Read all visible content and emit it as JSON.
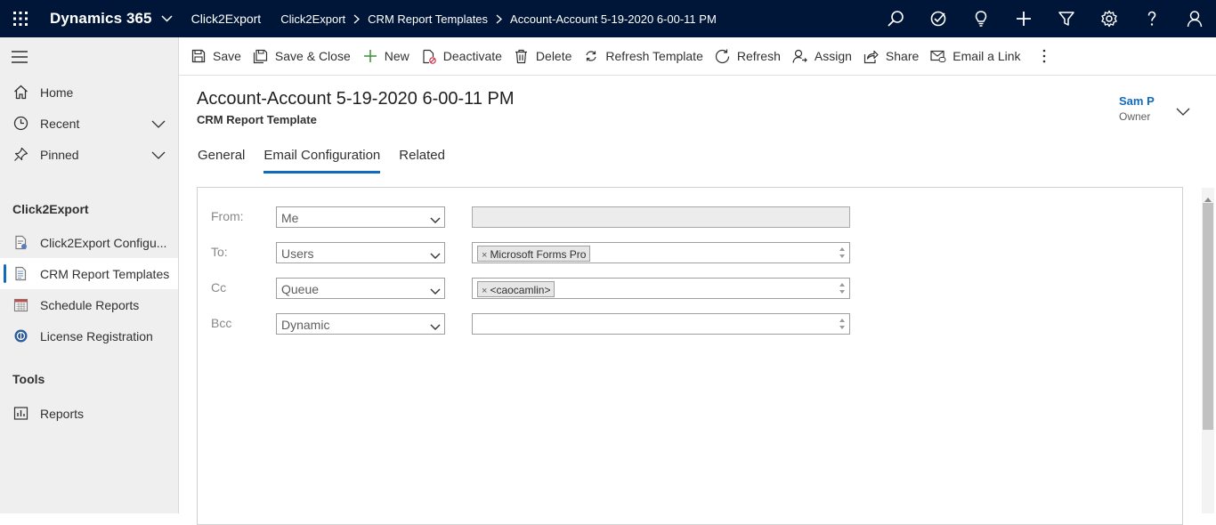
{
  "topbar": {
    "brand": "Dynamics 365",
    "app_name": "Click2Export",
    "breadcrumb": [
      "Click2Export",
      "CRM Report Templates",
      "Account-Account 5-19-2020 6-00-11 PM"
    ],
    "icons": [
      "search-icon",
      "task-check-icon",
      "lightbulb-icon",
      "plus-icon",
      "filter-icon",
      "settings-gear-icon",
      "help-icon",
      "user-icon"
    ]
  },
  "sidebar": {
    "nav": [
      {
        "label": "Home",
        "icon": "home-icon"
      },
      {
        "label": "Recent",
        "icon": "clock-icon"
      },
      {
        "label": "Pinned",
        "icon": "pin-icon"
      }
    ],
    "section1_title": "Click2Export",
    "section1_items": [
      {
        "label": "Click2Export Configu...",
        "icon": "config-doc-icon"
      },
      {
        "label": "CRM Report Templates",
        "icon": "template-doc-icon",
        "selected": true
      },
      {
        "label": "Schedule Reports",
        "icon": "calendar-icon"
      },
      {
        "label": "License Registration",
        "icon": "license-globe-icon"
      }
    ],
    "section2_title": "Tools",
    "section2_items": [
      {
        "label": "Reports",
        "icon": "reports-icon"
      }
    ]
  },
  "commands": [
    {
      "label": "Save",
      "icon": "save-icon"
    },
    {
      "label": "Save & Close",
      "icon": "save-close-icon"
    },
    {
      "label": "New",
      "icon": "plus-icon"
    },
    {
      "label": "Deactivate",
      "icon": "deactivate-icon"
    },
    {
      "label": "Delete",
      "icon": "trash-icon"
    },
    {
      "label": "Refresh Template",
      "icon": "sync-icon"
    },
    {
      "label": "Refresh",
      "icon": "refresh-icon"
    },
    {
      "label": "Assign",
      "icon": "assign-person-icon"
    },
    {
      "label": "Share",
      "icon": "share-icon"
    },
    {
      "label": "Email a Link",
      "icon": "email-link-icon"
    }
  ],
  "header": {
    "title": "Account-Account 5-19-2020 6-00-11 PM",
    "subtitle": "CRM Report Template",
    "owner_name": "Sam P",
    "owner_label": "Owner"
  },
  "tabs": [
    {
      "label": "General",
      "active": false
    },
    {
      "label": "Email Configuration",
      "active": true
    },
    {
      "label": "Related",
      "active": false
    }
  ],
  "form": {
    "rows": [
      {
        "label": "From:",
        "select_value": "Me",
        "tag": "",
        "disabled": true
      },
      {
        "label": "To:",
        "select_value": "Users",
        "tag": "Microsoft Forms Pro",
        "disabled": false
      },
      {
        "label": "Cc",
        "select_value": "Queue",
        "tag": "<caocamlin>",
        "disabled": false
      },
      {
        "label": "Bcc",
        "select_value": "Dynamic",
        "tag": "",
        "disabled": false
      }
    ],
    "tag_remove_glyph": "×"
  },
  "colors": {
    "topbar": "#001638",
    "accent": "#0f6cbd",
    "sidebar_bg": "#efefef"
  }
}
